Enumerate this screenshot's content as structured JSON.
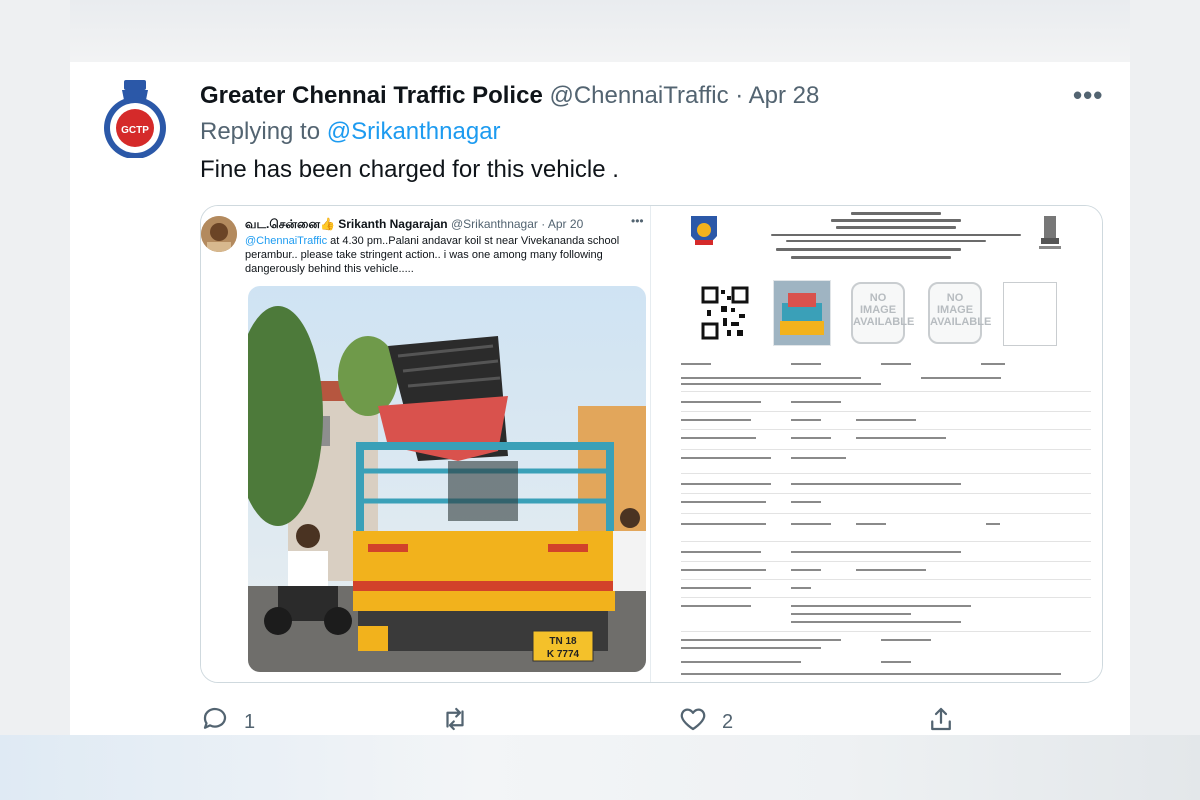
{
  "tweet": {
    "avatar_text": "GCTP",
    "name": "Greater Chennai Traffic Police",
    "handle": "@ChennaiTraffic",
    "separator": "·",
    "date": "Apr 28",
    "more": "•••",
    "replying_prefix": "Replying to",
    "replying_to": "@Srikanthnagar",
    "text": "Fine has been charged for this vehicle ."
  },
  "quoted": {
    "name": "வட.சென்னை👍 Srikanth Nagarajan",
    "meta": "@Srikanthnagar · Apr 20",
    "more": "•••",
    "mention": "@ChennaiTraffic",
    "text": " at 4.30 pm..Palani andavar koil st near Vivekananda school perambur.. please take stringent action.. i was one among many following dangerously behind this vehicle.....",
    "plate_line1": "TN 18",
    "plate_line2": "K 7774"
  },
  "challan": {
    "no_image_1": "NO IMAGE AVAILABLE",
    "no_image_2": "NO IMAGE AVAILABLE"
  },
  "actions": {
    "reply_count": "1",
    "retweet_count": "",
    "like_count": "2"
  },
  "colors": {
    "accent": "#1d9bf0",
    "secondary_text": "#536471",
    "truck_yellow": "#f2b21c",
    "truck_cab": "#3aa0b8"
  }
}
